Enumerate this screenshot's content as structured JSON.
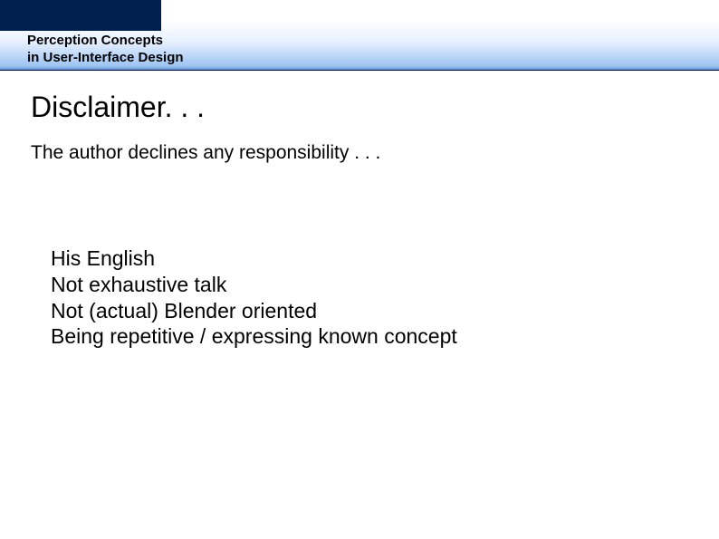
{
  "header": {
    "title_line1": "Perception Concepts",
    "title_line2": "in User-Interface Design"
  },
  "slide": {
    "title": "Disclaimer. . .",
    "subtitle": "The author declines any responsibility . . .",
    "points": [
      "His English",
      "Not exhaustive talk",
      "Not (actual) Blender oriented",
      "Being repetitive / expressing known concept"
    ]
  }
}
